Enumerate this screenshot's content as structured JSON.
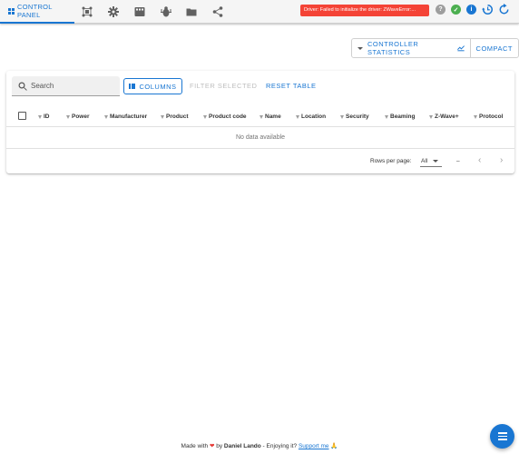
{
  "topbar": {
    "tab_control_panel": "CONTROL PANEL",
    "nav_icons": [
      "network-graph-icon",
      "settings-icon",
      "scenes-icon",
      "debug-icon",
      "store-icon",
      "share-icon"
    ],
    "error_badge": "Driver: Failed to initialize the driver: ZWaveError:...",
    "status_icons": [
      "help-icon",
      "mqtt-status-icon",
      "info-icon",
      "history-icon",
      "refresh-icon"
    ]
  },
  "stats": {
    "controller_statistics": "CONTROLLER STATISTICS",
    "compact": "COMPACT"
  },
  "toolbar": {
    "search_placeholder": "Search",
    "columns_label": "COLUMNS",
    "filter_selected_label": "FILTER SELECTED",
    "reset_table_label": "RESET TABLE"
  },
  "table": {
    "headers": [
      "ID",
      "Power",
      "Manufacturer",
      "Product",
      "Product code",
      "Name",
      "Location",
      "Security",
      "Beaming",
      "Z-Wave+",
      "Protocol"
    ],
    "empty_text": "No data available",
    "rows_per_page_label": "Rows per page:",
    "rows_per_page_value": "All",
    "range_text": "–"
  },
  "footer": {
    "made_with": "Made with",
    "by": "by",
    "author": "Daniel Lando",
    "enjoying": "- Enjoying it?",
    "support": "Support me",
    "support_emoji": "🙏"
  },
  "colors": {
    "accent": "#1976d2",
    "error": "#f44336",
    "mqtt_ok": "#4caf50"
  }
}
